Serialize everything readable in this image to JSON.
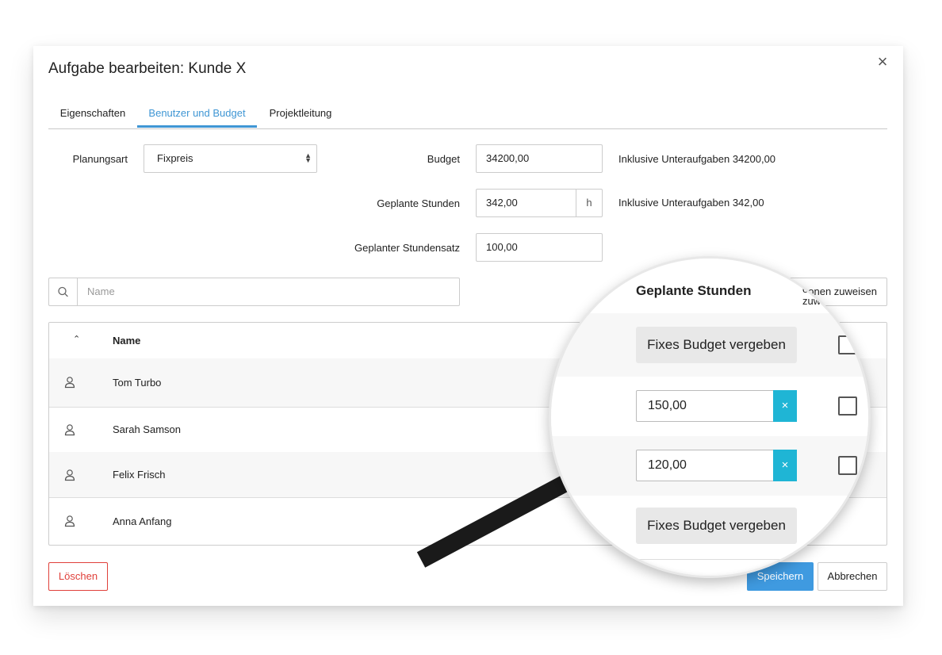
{
  "dialog": {
    "title": "Aufgabe bearbeiten: Kunde X",
    "close_symbol": "×"
  },
  "tabs": [
    {
      "label": "Eigenschaften",
      "active": false
    },
    {
      "label": "Benutzer und Budget",
      "active": true
    },
    {
      "label": "Projektleitung",
      "active": false
    }
  ],
  "form": {
    "planungsart_label": "Planungsart",
    "planungsart_value": "Fixpreis",
    "budget_label": "Budget",
    "budget_value": "34200,00",
    "budget_info": "Inklusive Unteraufgaben 34200,00",
    "stunden_label": "Geplante Stunden",
    "stunden_value": "342,00",
    "stunden_unit": "h",
    "stunden_info": "Inklusive Unteraufgaben 342,00",
    "stundensatz_label": "Geplanter Stundensatz",
    "stundensatz_value": "100,00"
  },
  "search": {
    "placeholder": "Name",
    "icon": "search-icon"
  },
  "assign_button": "onen zuweisen",
  "table": {
    "sort_symbol": "⌃",
    "header_name": "Name",
    "rows": [
      {
        "name": "Tom Turbo",
        "icon": "user-icon"
      },
      {
        "name": "Sarah Samson",
        "icon": "user-icon"
      },
      {
        "name": "Felix Frisch",
        "icon": "user-icon"
      },
      {
        "name": "Anna Anfang",
        "icon": "user-icon"
      }
    ]
  },
  "magnifier": {
    "header": "Geplante Stunden",
    "assign_fragment": "onen zuweisen",
    "rows": [
      {
        "type": "button",
        "label": "Fixes Budget vergeben"
      },
      {
        "type": "input",
        "value": "150,00",
        "clear": "×"
      },
      {
        "type": "input",
        "value": "120,00",
        "clear": "×"
      },
      {
        "type": "button",
        "label": "Fixes Budget vergeben"
      }
    ]
  },
  "footer": {
    "delete": "Löschen",
    "save": "Speichern",
    "cancel": "Abbrechen"
  },
  "colors": {
    "accent": "#3f96d4",
    "danger": "#e0403a",
    "clear_button": "#1fb5d5"
  }
}
